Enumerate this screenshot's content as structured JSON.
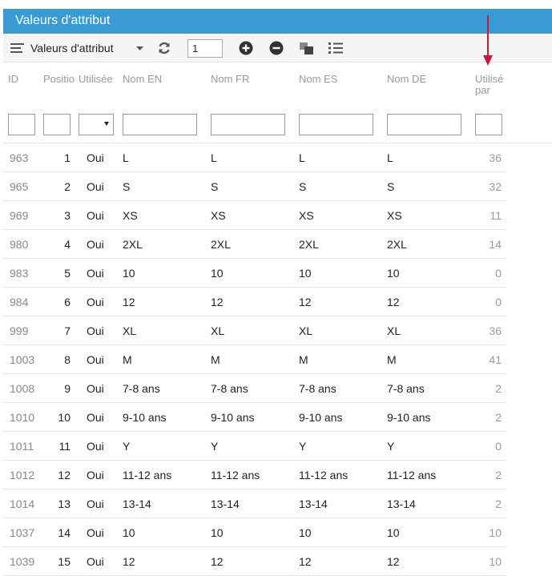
{
  "panel": {
    "title": "Valeurs d'attribut"
  },
  "toolbar": {
    "menu_label": "Valeurs d'attribut",
    "page_value": "1"
  },
  "columns": {
    "id": "ID",
    "position": "Positio",
    "used": "Utilisée",
    "name_en": "Nom EN",
    "name_fr": "Nom FR",
    "name_es": "Nom ES",
    "name_de": "Nom DE",
    "used_by": "Utilisé par"
  },
  "colors": {
    "header_bar": "#3a9ad4",
    "annotation_arrow": "#c8163c"
  },
  "rows": [
    {
      "id": "963",
      "position": "1",
      "used": "Oui",
      "name_en": "L",
      "name_fr": "L",
      "name_es": "L",
      "name_de": "L",
      "used_by": "36"
    },
    {
      "id": "965",
      "position": "2",
      "used": "Oui",
      "name_en": "S",
      "name_fr": "S",
      "name_es": "S",
      "name_de": "S",
      "used_by": "32"
    },
    {
      "id": "969",
      "position": "3",
      "used": "Oui",
      "name_en": "XS",
      "name_fr": "XS",
      "name_es": "XS",
      "name_de": "XS",
      "used_by": "11"
    },
    {
      "id": "980",
      "position": "4",
      "used": "Oui",
      "name_en": "2XL",
      "name_fr": "2XL",
      "name_es": "2XL",
      "name_de": "2XL",
      "used_by": "14"
    },
    {
      "id": "983",
      "position": "5",
      "used": "Oui",
      "name_en": "10",
      "name_fr": "10",
      "name_es": "10",
      "name_de": "10",
      "used_by": "0"
    },
    {
      "id": "984",
      "position": "6",
      "used": "Oui",
      "name_en": "12",
      "name_fr": "12",
      "name_es": "12",
      "name_de": "12",
      "used_by": "0"
    },
    {
      "id": "999",
      "position": "7",
      "used": "Oui",
      "name_en": "XL",
      "name_fr": "XL",
      "name_es": "XL",
      "name_de": "XL",
      "used_by": "36"
    },
    {
      "id": "1003",
      "position": "8",
      "used": "Oui",
      "name_en": "M",
      "name_fr": "M",
      "name_es": "M",
      "name_de": "M",
      "used_by": "41"
    },
    {
      "id": "1008",
      "position": "9",
      "used": "Oui",
      "name_en": "7-8 ans",
      "name_fr": "7-8 ans",
      "name_es": "7-8 ans",
      "name_de": "7-8 ans",
      "used_by": "2"
    },
    {
      "id": "1010",
      "position": "10",
      "used": "Oui",
      "name_en": "9-10 ans",
      "name_fr": "9-10 ans",
      "name_es": "9-10 ans",
      "name_de": "9-10 ans",
      "used_by": "2"
    },
    {
      "id": "1011",
      "position": "11",
      "used": "Oui",
      "name_en": "Y",
      "name_fr": "Y",
      "name_es": "Y",
      "name_de": "Y",
      "used_by": "0"
    },
    {
      "id": "1012",
      "position": "12",
      "used": "Oui",
      "name_en": "11-12 ans",
      "name_fr": "11-12 ans",
      "name_es": "11-12 ans",
      "name_de": "11-12 ans",
      "used_by": "2"
    },
    {
      "id": "1014",
      "position": "13",
      "used": "Oui",
      "name_en": "13-14",
      "name_fr": "13-14",
      "name_es": "13-14",
      "name_de": "13-14",
      "used_by": "2"
    },
    {
      "id": "1037",
      "position": "14",
      "used": "Oui",
      "name_en": "10",
      "name_fr": "10",
      "name_es": "10",
      "name_de": "10",
      "used_by": "10"
    },
    {
      "id": "1039",
      "position": "15",
      "used": "Oui",
      "name_en": "12",
      "name_fr": "12",
      "name_es": "12",
      "name_de": "12",
      "used_by": "10"
    }
  ]
}
